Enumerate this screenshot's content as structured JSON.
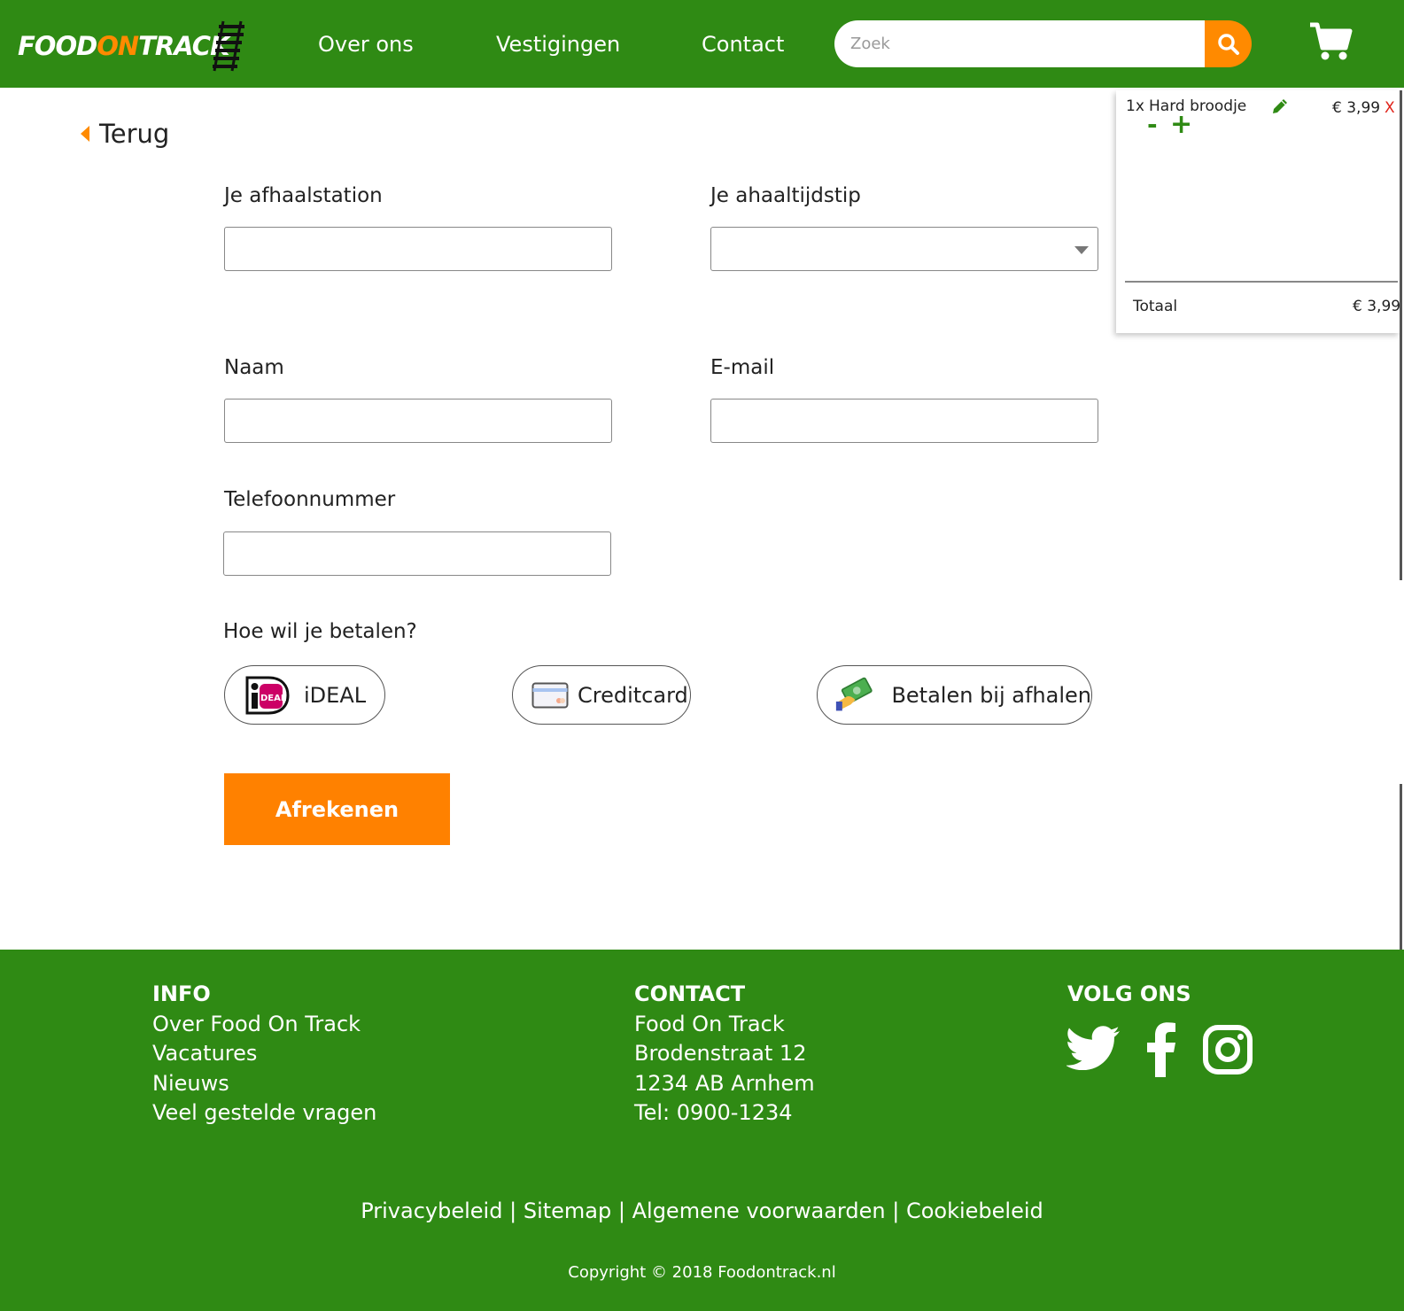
{
  "header": {
    "logo": {
      "part1": "FOOD",
      "part2": "ON",
      "part3": "TRACK"
    },
    "nav": [
      "Over ons",
      "Vestigingen",
      "Contact"
    ],
    "search": {
      "placeholder": "Zoek",
      "value": ""
    },
    "icons": {
      "search": "search-icon",
      "cart": "shopping-cart-icon"
    }
  },
  "back": {
    "label": "Terug",
    "icon": "caret-left-icon"
  },
  "form": {
    "station_label": "Je afhaalstation",
    "time_label": "Je ahaaltijdstip",
    "name_label": "Naam",
    "email_label": "E-mail",
    "phone_label": "Telefoonnummer",
    "payment_question": "Hoe wil je betalen?",
    "payment_options": [
      {
        "label": "iDEAL",
        "icon": "ideal-logo-icon",
        "icon_text": "DEAL"
      },
      {
        "label": "Creditcard",
        "icon": "credit-card-icon"
      },
      {
        "label": "Betalen bij afhalen",
        "icon": "cash-hand-icon"
      }
    ],
    "checkout_label": "Afrekenen"
  },
  "cart": {
    "items": [
      {
        "qty": "1x",
        "name": "Hard broodje",
        "price": "€ 3,99",
        "remove": "X",
        "minus": "-",
        "plus": "+"
      }
    ],
    "total_label": "Totaal",
    "total_value": "€ 3,99"
  },
  "footer": {
    "info_heading": "INFO",
    "info_links": [
      "Over Food On Track",
      "Vacatures",
      "Nieuws",
      "Veel gestelde vragen"
    ],
    "contact_heading": "CONTACT",
    "contact_lines": [
      "Food On Track",
      "Brodenstraat 12",
      "1234 AB Arnhem",
      "Tel: 0900-1234"
    ],
    "social_heading": "VOLG ONS",
    "social_icons": [
      "twitter-icon",
      "facebook-icon",
      "instagram-icon"
    ],
    "bottom_links": [
      "Privacybeleid",
      "Sitemap",
      "Algemene voorwaarden",
      "Cookiebeleid"
    ],
    "separator": "|",
    "copyright": "Copyright © 2018 Foodontrack.nl"
  },
  "colors": {
    "brand_green": "#2f8a14",
    "accent_orange": "#ff8a00",
    "remove_red": "#e0231a"
  }
}
